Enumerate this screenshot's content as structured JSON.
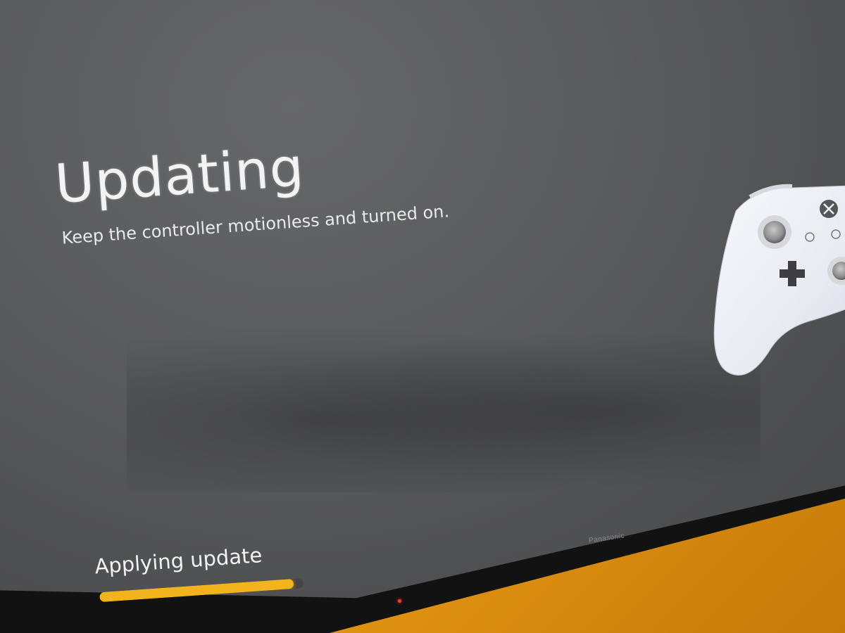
{
  "screen": {
    "title": "Updating",
    "subtitle": "Keep the controller motionless and turned on.",
    "status": "Applying update",
    "progress_percent": 95
  },
  "tv": {
    "brand": "Panasonic"
  },
  "colors": {
    "accent": "#f3b31c",
    "screen_bg": "#5a5b5d",
    "text": "#f3f3f3",
    "wall": "#e9a21e"
  },
  "icons": {
    "controller": "xbox-controller-icon",
    "logo": "xbox-logo-icon"
  }
}
